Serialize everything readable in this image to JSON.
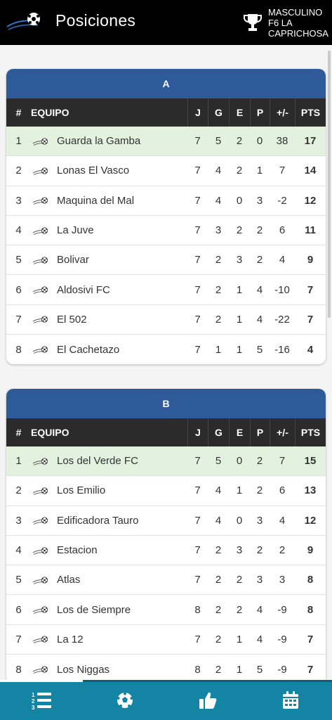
{
  "header": {
    "title": "Posiciones",
    "category_lines": [
      "MASCULINO",
      "F6 LA",
      "CAPRICHOSA"
    ]
  },
  "columns": {
    "pos": "#",
    "team": "EQUIPO",
    "j": "J",
    "g": "G",
    "e": "E",
    "p": "P",
    "dif": "+/-",
    "pts": "PTS"
  },
  "groups": [
    {
      "name": "A",
      "rows": [
        {
          "pos": "1",
          "team": "Guarda la Gamba",
          "j": "7",
          "g": "5",
          "e": "2",
          "p": "0",
          "dif": "38",
          "pts": "17",
          "leader": true
        },
        {
          "pos": "2",
          "team": "Lonas El Vasco",
          "j": "7",
          "g": "4",
          "e": "2",
          "p": "1",
          "dif": "7",
          "pts": "14"
        },
        {
          "pos": "3",
          "team": "Maquina del Mal",
          "j": "7",
          "g": "4",
          "e": "0",
          "p": "3",
          "dif": "-2",
          "pts": "12"
        },
        {
          "pos": "4",
          "team": "La Juve",
          "j": "7",
          "g": "3",
          "e": "2",
          "p": "2",
          "dif": "6",
          "pts": "11"
        },
        {
          "pos": "5",
          "team": "Bolivar",
          "j": "7",
          "g": "2",
          "e": "3",
          "p": "2",
          "dif": "4",
          "pts": "9"
        },
        {
          "pos": "6",
          "team": "Aldosivi FC",
          "j": "7",
          "g": "2",
          "e": "1",
          "p": "4",
          "dif": "-10",
          "pts": "7"
        },
        {
          "pos": "7",
          "team": "El 502",
          "j": "7",
          "g": "2",
          "e": "1",
          "p": "4",
          "dif": "-22",
          "pts": "7"
        },
        {
          "pos": "8",
          "team": "El Cachetazo",
          "j": "7",
          "g": "1",
          "e": "1",
          "p": "5",
          "dif": "-16",
          "pts": "4"
        }
      ]
    },
    {
      "name": "B",
      "rows": [
        {
          "pos": "1",
          "team": "Los del Verde FC",
          "j": "7",
          "g": "5",
          "e": "0",
          "p": "2",
          "dif": "7",
          "pts": "15",
          "leader": true
        },
        {
          "pos": "2",
          "team": "Los Emilio",
          "j": "7",
          "g": "4",
          "e": "1",
          "p": "2",
          "dif": "6",
          "pts": "13"
        },
        {
          "pos": "3",
          "team": "Edificadora Tauro",
          "j": "7",
          "g": "4",
          "e": "0",
          "p": "3",
          "dif": "4",
          "pts": "12"
        },
        {
          "pos": "4",
          "team": "Estacion",
          "j": "7",
          "g": "2",
          "e": "3",
          "p": "2",
          "dif": "2",
          "pts": "9"
        },
        {
          "pos": "5",
          "team": "Atlas",
          "j": "7",
          "g": "2",
          "e": "2",
          "p": "3",
          "dif": "3",
          "pts": "8"
        },
        {
          "pos": "6",
          "team": "Los de Siempre",
          "j": "8",
          "g": "2",
          "e": "2",
          "p": "4",
          "dif": "-9",
          "pts": "8"
        },
        {
          "pos": "7",
          "team": "La 12",
          "j": "7",
          "g": "2",
          "e": "1",
          "p": "4",
          "dif": "-9",
          "pts": "7"
        },
        {
          "pos": "8",
          "team": "Los Niggas",
          "j": "8",
          "g": "2",
          "e": "1",
          "p": "5",
          "dif": "-9",
          "pts": "7"
        }
      ]
    }
  ],
  "nav": {
    "items": [
      "standings-icon",
      "soccer-ball-icon",
      "thumbs-up-icon",
      "calendar-icon"
    ],
    "active": "standings-icon"
  },
  "colors": {
    "header_bg": "#000000",
    "group_title_bg": "#2e5a9a",
    "table_head_bg": "#2b2b2b",
    "leader_row_bg": "#e3f1df",
    "nav_bg": "#1384a3"
  }
}
